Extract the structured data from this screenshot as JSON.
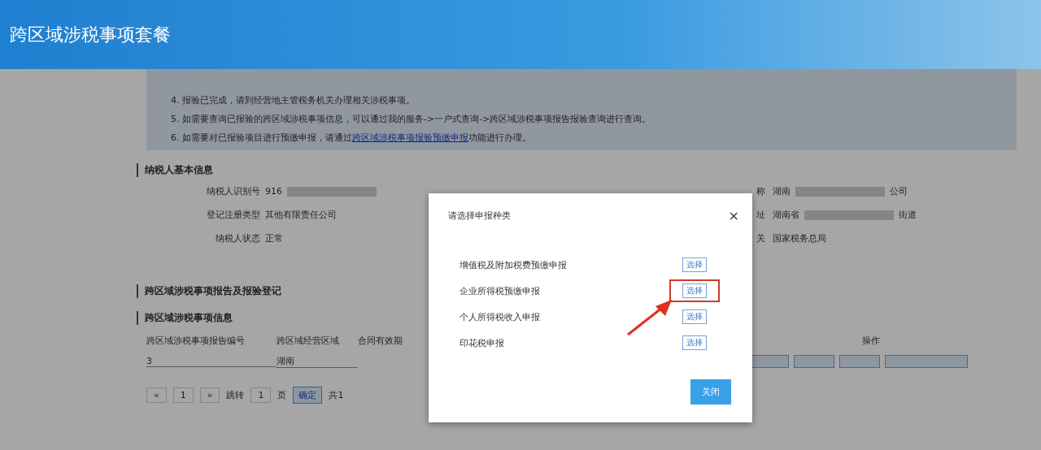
{
  "header": {
    "title": "跨区域涉税事项套餐"
  },
  "notices": [
    {
      "text": "4. 报验已完成，请到经营地主管税务机关办理相关涉税事项。"
    },
    {
      "text": "5. 如需要查询已报验的跨区域涉税事项信息，可以通过我的服务->一户式查询->跨区域涉税事项报告报验查询进行查询。"
    },
    {
      "text": "6. 如需要对已报验项目进行预缴申报，请通过",
      "link": "跨区域涉税事项报验预缴申报",
      "after": "功能进行办理。"
    }
  ],
  "sections": [
    {
      "title": "纳税人基本信息"
    },
    {
      "title": "跨区域涉税事项报告及报验登记"
    },
    {
      "title": "跨区域涉税事项信息"
    }
  ],
  "basic_info": [
    {
      "label": "纳税人识别号",
      "value": "916"
    },
    {
      "label": "登记注册类型",
      "value": "其他有限责任公司"
    },
    {
      "label": "纳税人状态",
      "value": "正常"
    }
  ],
  "basic_info_right": [
    {
      "label": "称",
      "value": "湖南",
      "tail": "公司"
    },
    {
      "label": "址",
      "value": "湖南省",
      "tail": "街道"
    },
    {
      "label": "关",
      "value": "国家税务总局"
    }
  ],
  "table": {
    "columns": [
      "跨区域涉税事项报告编号",
      "跨区域经营区域",
      "合同有效期"
    ],
    "action_header": "操作",
    "row": {
      "cells": [
        "3",
        "湖南"
      ]
    }
  },
  "pagination": {
    "prev": "«",
    "page": "1",
    "next": "»",
    "jump": "跳转",
    "page_input": "1",
    "page_unit": "页",
    "confirm": "确定",
    "total": "共1"
  },
  "dialog": {
    "title": "请选择申报种类",
    "close": "×",
    "options": [
      {
        "label": "增值税及附加税费预缴申报",
        "button": "选择",
        "highlighted": false
      },
      {
        "label": "企业所得税预缴申报",
        "button": "选择",
        "highlighted": true
      },
      {
        "label": "个人所得税收入申报",
        "button": "选择",
        "highlighted": false
      },
      {
        "label": "印花税申报",
        "button": "选择",
        "highlighted": false
      }
    ],
    "close_button": "关闭"
  }
}
